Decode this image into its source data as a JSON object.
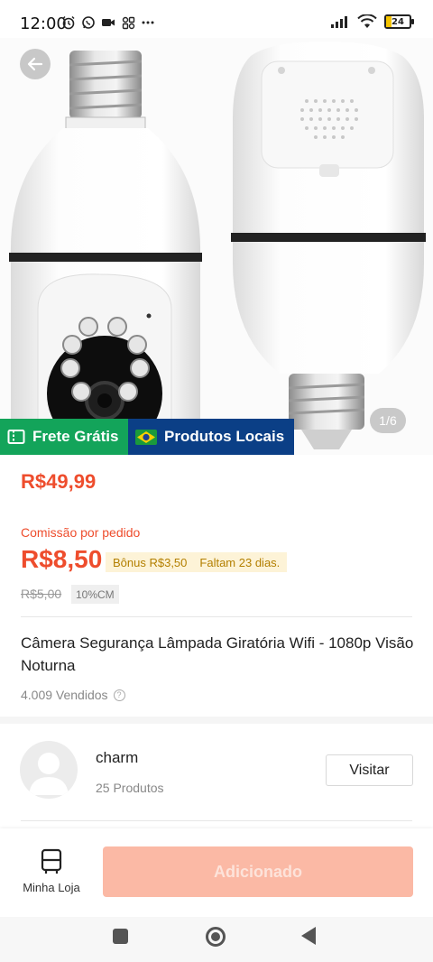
{
  "status_bar": {
    "time": "12:00",
    "battery": "24"
  },
  "product": {
    "image_counter": "1/6",
    "badges": {
      "free_shipping": "Frete Grátis",
      "local_products": "Produtos Locais"
    },
    "price": "R$49,99",
    "commission_label": "Comissão por pedido",
    "commission_value": "R$8,50",
    "bonus": "Bônus R$3,50",
    "days_left": "Faltam 23 dias.",
    "old_commission": "R$5,00",
    "commission_percent": "10%CM",
    "title": "Câmera Segurança Lâmpada Giratória Wifi - 1080p Visão Noturna",
    "sold": "4.009 Vendidos"
  },
  "shop": {
    "name": "charm",
    "products": "25 Produtos",
    "visit_label": "Visitar"
  },
  "bottom_bar": {
    "my_store_label": "Minha Loja",
    "add_label": "Adicionado"
  },
  "colors": {
    "accent": "#ee4d2d",
    "free_shipping_bg": "#13a45a",
    "local_products_bg": "#0b3f86",
    "add_button_bg": "#fbb9a5"
  }
}
